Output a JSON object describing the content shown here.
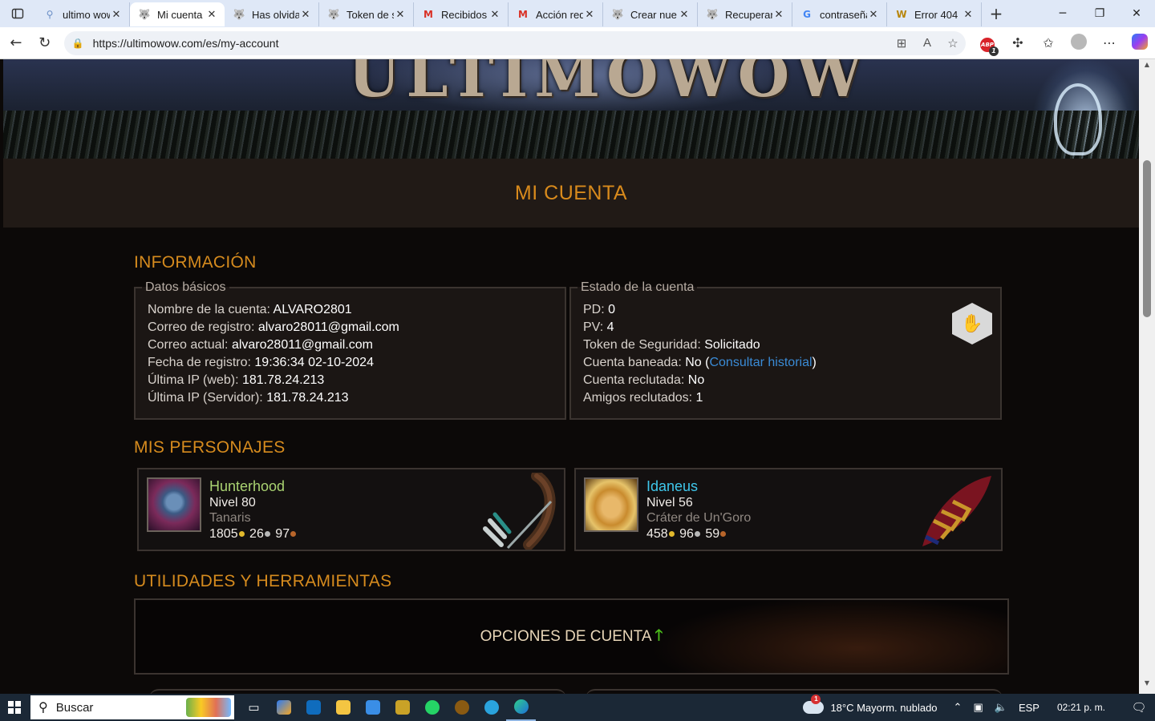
{
  "browser": {
    "tabs": [
      {
        "title": "ultimo wow",
        "icon": "search-icon",
        "active": false
      },
      {
        "title": "Mi cuenta",
        "icon": "wolf-icon",
        "active": true
      },
      {
        "title": "Has olvida",
        "icon": "wolf-icon",
        "active": false
      },
      {
        "title": "Token de s",
        "icon": "wolf-icon",
        "active": false
      },
      {
        "title": "Recibidos",
        "icon": "gmail-icon",
        "active": false
      },
      {
        "title": "Acción req",
        "icon": "gmail-icon",
        "active": false
      },
      {
        "title": "Crear nue",
        "icon": "wolf-icon",
        "active": false
      },
      {
        "title": "Recuperar",
        "icon": "wolf-icon",
        "active": false
      },
      {
        "title": "contraseña",
        "icon": "google-icon",
        "active": false
      },
      {
        "title": "Error 404",
        "icon": "wow-icon",
        "active": false
      }
    ],
    "url": "https://ultimowow.com/es/my-account",
    "adblock_count": "1"
  },
  "page": {
    "title": "MI CUENTA",
    "info_heading": "INFORMACIÓN",
    "basic": {
      "legend": "Datos básicos",
      "rows": [
        {
          "label": "Nombre de la cuenta:",
          "value": "ALVARO2801"
        },
        {
          "label": "Correo de registro:",
          "value": "alvaro28011@gmail.com"
        },
        {
          "label": "Correo actual:",
          "value": "alvaro28011@gmail.com"
        },
        {
          "label": "Fecha de registro:",
          "value": "19:36:34 02-10-2024"
        },
        {
          "label": "Última IP (web):",
          "value": "181.78.24.213"
        },
        {
          "label": "Última IP (Servidor):",
          "value": "181.78.24.213"
        }
      ]
    },
    "status": {
      "legend": "Estado de la cuenta",
      "pd": {
        "label": "PD:",
        "value": "0"
      },
      "pv": {
        "label": "PV:",
        "value": "4"
      },
      "token": {
        "label": "Token de Seguridad:",
        "value": "Solicitado"
      },
      "banned": {
        "label": "Cuenta baneada:",
        "value": "No",
        "open": " (",
        "link": "Consultar historial",
        "close": ")"
      },
      "recruited": {
        "label": "Cuenta reclutada:",
        "value": "No"
      },
      "friends": {
        "label": "Amigos reclutados:",
        "value": "1"
      }
    },
    "chars_heading": "MIS PERSONAJES",
    "characters": [
      {
        "name": "Hunterhood",
        "level": "Nivel 80",
        "zone": "Tanaris",
        "gold": "1805",
        "silver": "26",
        "copper": "97",
        "name_color": "#a9d271"
      },
      {
        "name": "Idaneus",
        "level": "Nivel 56",
        "zone": "Cráter de Un'Goro",
        "gold": "458",
        "silver": "96",
        "copper": "59",
        "name_color": "#3fc7eb"
      }
    ],
    "utils_heading": "UTILIDADES Y HERRAMIENTAS",
    "options_label": "OPCIONES DE CUENTA",
    "options_arrow": "🡑"
  },
  "taskbar": {
    "search_placeholder": "Buscar",
    "weather_badge": "1",
    "weather": "18°C  Mayorm. nublado",
    "lang": "ESP",
    "time": "02:21 p. m."
  }
}
